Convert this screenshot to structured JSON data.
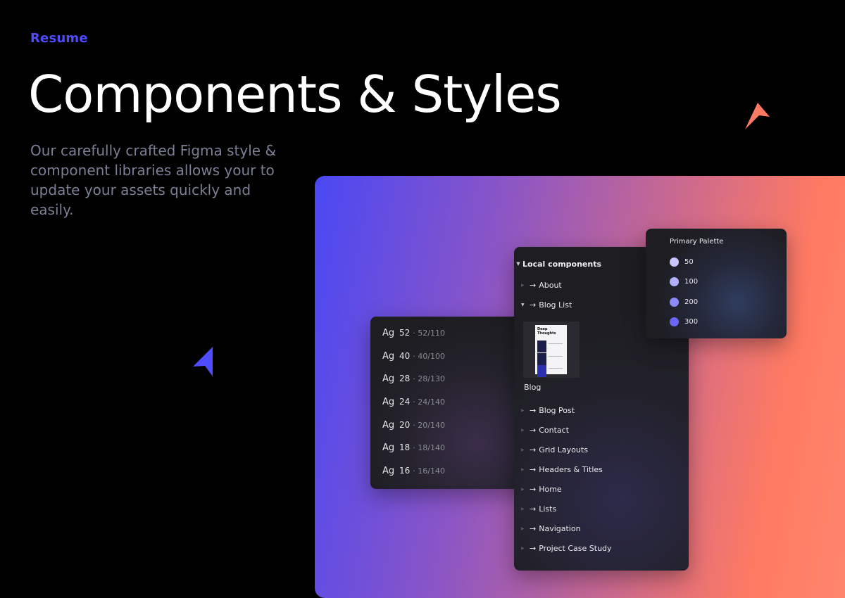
{
  "header": {
    "eyebrow": "Resume",
    "title": "Components & Styles",
    "description": "Our carefully crafted Figma style & component libraries allows your to update your assets quickly and easily."
  },
  "colors": {
    "accent_blue": "#4f4bff",
    "accent_orange": "#ff7a62",
    "gradient_start": "#4a48f4",
    "gradient_end": "#ff8a70"
  },
  "type_styles": [
    {
      "ag": "Ag",
      "size": "52",
      "spec": "· 52/110"
    },
    {
      "ag": "Ag",
      "size": "40",
      "spec": "· 40/100"
    },
    {
      "ag": "Ag",
      "size": "28",
      "spec": "· 28/130"
    },
    {
      "ag": "Ag",
      "size": "24",
      "spec": "· 24/140"
    },
    {
      "ag": "Ag",
      "size": "20",
      "spec": "· 20/140"
    },
    {
      "ag": "Ag",
      "size": "18",
      "spec": "· 18/140"
    },
    {
      "ag": "Ag",
      "size": "16",
      "spec": "· 16/140"
    }
  ],
  "components": {
    "header": "Local components",
    "items": [
      {
        "label": "About",
        "expanded": false
      },
      {
        "label": "Blog List",
        "expanded": true
      },
      {
        "label": "Blog Post",
        "expanded": false
      },
      {
        "label": "Contact",
        "expanded": false
      },
      {
        "label": "Grid Layouts",
        "expanded": false
      },
      {
        "label": "Headers & Titles",
        "expanded": false
      },
      {
        "label": "Home",
        "expanded": false
      },
      {
        "label": "Lists",
        "expanded": false
      },
      {
        "label": "Navigation",
        "expanded": false
      },
      {
        "label": "Project Case Study",
        "expanded": false
      }
    ],
    "thumbnail_text": "Deep Thoughts",
    "thumbnail_label": "Blog"
  },
  "palette": {
    "title": "Primary Palette",
    "swatches": [
      {
        "label": "50",
        "color": "#c9c6ff"
      },
      {
        "label": "100",
        "color": "#b3b0ff"
      },
      {
        "label": "200",
        "color": "#8e8af8"
      },
      {
        "label": "300",
        "color": "#6b66f5"
      }
    ]
  },
  "icons": [
    "cursor-arrow-orange-icon",
    "cursor-arrow-blue-icon",
    "caret-down-icon",
    "caret-right-icon",
    "arrow-right-icon"
  ]
}
